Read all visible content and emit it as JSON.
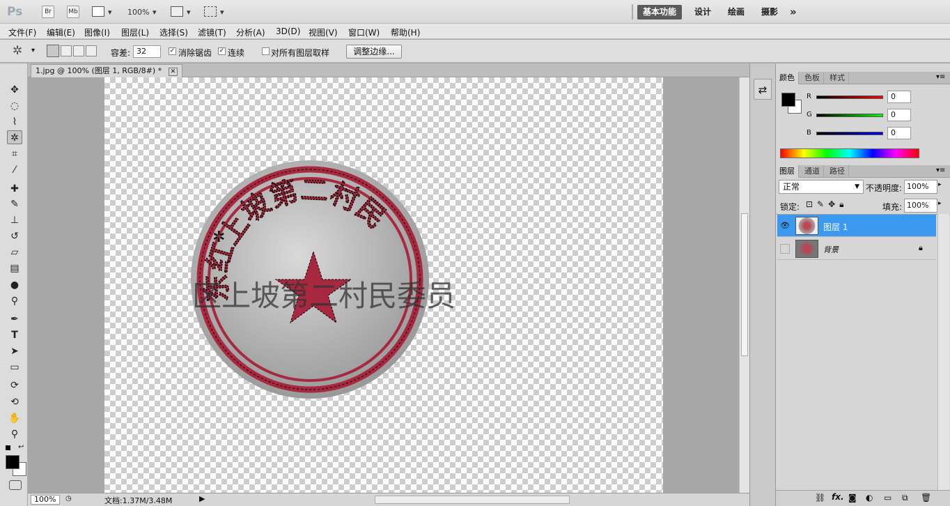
{
  "appbar": {
    "logo": "Ps",
    "bridge": "Br",
    "minibridge": "Mb",
    "zoom": "100%",
    "workspaces": [
      "基本功能",
      "设计",
      "绘画",
      "摄影"
    ],
    "more": "»"
  },
  "menus": [
    "文件(F)",
    "编辑(E)",
    "图像(I)",
    "图层(L)",
    "选择(S)",
    "滤镜(T)",
    "分析(A)",
    "3D(D)",
    "视图(V)",
    "窗口(W)",
    "帮助(H)"
  ],
  "options": {
    "tolerance_label": "容差:",
    "tolerance_value": "32",
    "antialias": "消除锯齿",
    "contiguous": "连续",
    "sample_all": "对所有图层取样",
    "refine_edge": "调整边缘..."
  },
  "document": {
    "tab": "1.jpg @ 100% (图层 1, RGB/8#) *",
    "zoom": "100%",
    "doc_size": "文档:1.37M/3.48M"
  },
  "stamp": {
    "outer_text": "东红上坡第二村民",
    "overlay_text": "区上坡第二村民委员"
  },
  "color_panel": {
    "tabs": [
      "颜色",
      "色板",
      "样式"
    ],
    "r_label": "R",
    "g_label": "G",
    "b_label": "B",
    "r": "0",
    "g": "0",
    "b": "0"
  },
  "layers_panel": {
    "tabs": [
      "图层",
      "通道",
      "路径"
    ],
    "blend_mode": "正常",
    "opacity_label": "不透明度:",
    "opacity": "100%",
    "lock_label": "锁定:",
    "fill_label": "填充:",
    "fill": "100%",
    "layers": [
      {
        "name": "图层 1"
      },
      {
        "name": "背景"
      }
    ]
  },
  "colors": {
    "selected_layer": "#3c99f0",
    "stamp_red": "#a8283f",
    "active_workspace": "#5a5a5a"
  }
}
